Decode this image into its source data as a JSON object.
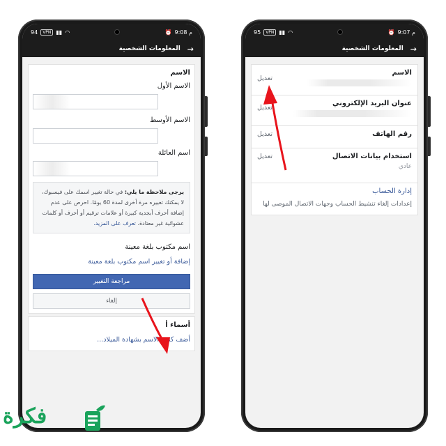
{
  "left": {
    "status": {
      "left": "94",
      "time": "9:08 م"
    },
    "appbar_title": "المعلومات الشخصية",
    "name_section_title": "الاسم",
    "first_name_label": "الاسم الأول",
    "middle_name_label": "الاسم الأوسط",
    "last_name_label": "اسم العائلة",
    "note_bold": "يرجى ملاحظة ما يلي:",
    "note_text": "في حالة تغيير اسمك على فيسبوك، لا يمكنك تغييره مرة أخرى لمدة 60 يومًا. احرص على عدم إضافة أحرف أبجدية كبيرة أو علامات ترقيم أو أحرف أو كلمات عشوائية غير معتادة.",
    "note_link": "تعرف على المزيد.",
    "lang_name_label": "اسم مكتوب بلغة معينة",
    "lang_name_link": "إضافة أو تغيير اسم مكتوب بلغة معينة",
    "review_button": "مراجعة التغيير",
    "cancel_button": "إلغاء",
    "other_names_title": "أسماء أ",
    "other_names_link": "أضف كنية، الاسم بشهادة الميلاد..."
  },
  "right": {
    "status": {
      "left": "95",
      "time": "9:07 م"
    },
    "appbar_title": "المعلومات الشخصية",
    "rows": [
      {
        "title": "الاسم",
        "edit": "تعديل"
      },
      {
        "title": "عنوان البريد الإلكتروني",
        "edit": "تعديل"
      },
      {
        "title": "رقم الهاتف",
        "edit": "تعديل"
      },
      {
        "title": "استخدام بيانات الاتصال",
        "edit": "تعديل",
        "value": "عادي"
      }
    ],
    "account": {
      "title": "إدارة الحساب",
      "desc": "إعدادات إلغاء تنشيط الحساب وجهات الاتصال الموصى لها"
    }
  },
  "logo": {
    "text": "فكرة"
  },
  "colors": {
    "primary": "#4267b2",
    "link": "#385898",
    "arrow": "#e8141c",
    "brand": "#1aa35b"
  },
  "icons": [
    "back-arrow-icon",
    "wifi-icon",
    "signal-icon",
    "battery-icon",
    "alarm-icon"
  ]
}
